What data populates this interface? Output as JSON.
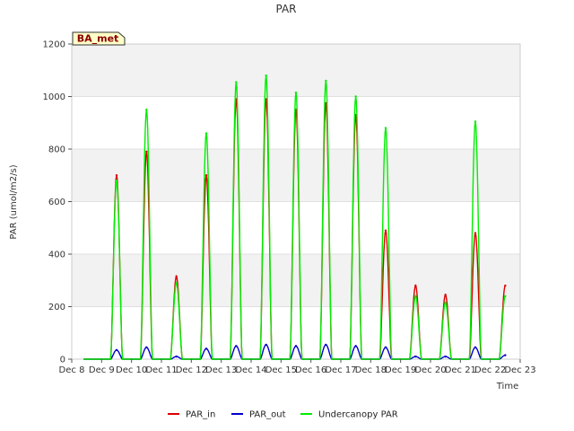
{
  "chart_data": {
    "type": "line",
    "title": "PAR",
    "xlabel": "Time",
    "ylabel": "PAR (umol/m2/s)",
    "station_badge": "BA_met",
    "x_ticks": [
      "Dec 8",
      "Dec 9",
      "Dec 10",
      "Dec 11",
      "Dec 12",
      "Dec 13",
      "Dec 14",
      "Dec 15",
      "Dec 16",
      "Dec 17",
      "Dec 18",
      "Dec 19",
      "Dec 20",
      "Dec 21",
      "Dec 22",
      "Dec 23"
    ],
    "xlim": [
      8,
      23
    ],
    "ylim": [
      0,
      1200
    ],
    "y_ticks": [
      0,
      200,
      400,
      600,
      800,
      1000,
      1200
    ],
    "grid": true,
    "legend_position": "bottom-center",
    "daily_peaks": {
      "days": [
        9,
        10,
        11,
        12,
        13,
        14,
        15,
        16,
        17,
        18,
        19,
        20,
        21,
        22
      ],
      "PAR_in": [
        700,
        790,
        315,
        700,
        990,
        990,
        950,
        975,
        930,
        490,
        280,
        245,
        480,
        280
      ],
      "PAR_out": [
        35,
        45,
        10,
        40,
        50,
        55,
        50,
        55,
        50,
        45,
        10,
        10,
        45,
        15
      ],
      "Undercanopy PAR": [
        680,
        950,
        290,
        860,
        1055,
        1080,
        1015,
        1060,
        1000,
        880,
        240,
        215,
        905,
        240
      ]
    },
    "series": [
      {
        "name": "PAR_in",
        "color": "#dd0000"
      },
      {
        "name": "PAR_out",
        "color": "#0000cc"
      },
      {
        "name": "Undercanopy PAR",
        "color": "#00ee00"
      }
    ]
  }
}
